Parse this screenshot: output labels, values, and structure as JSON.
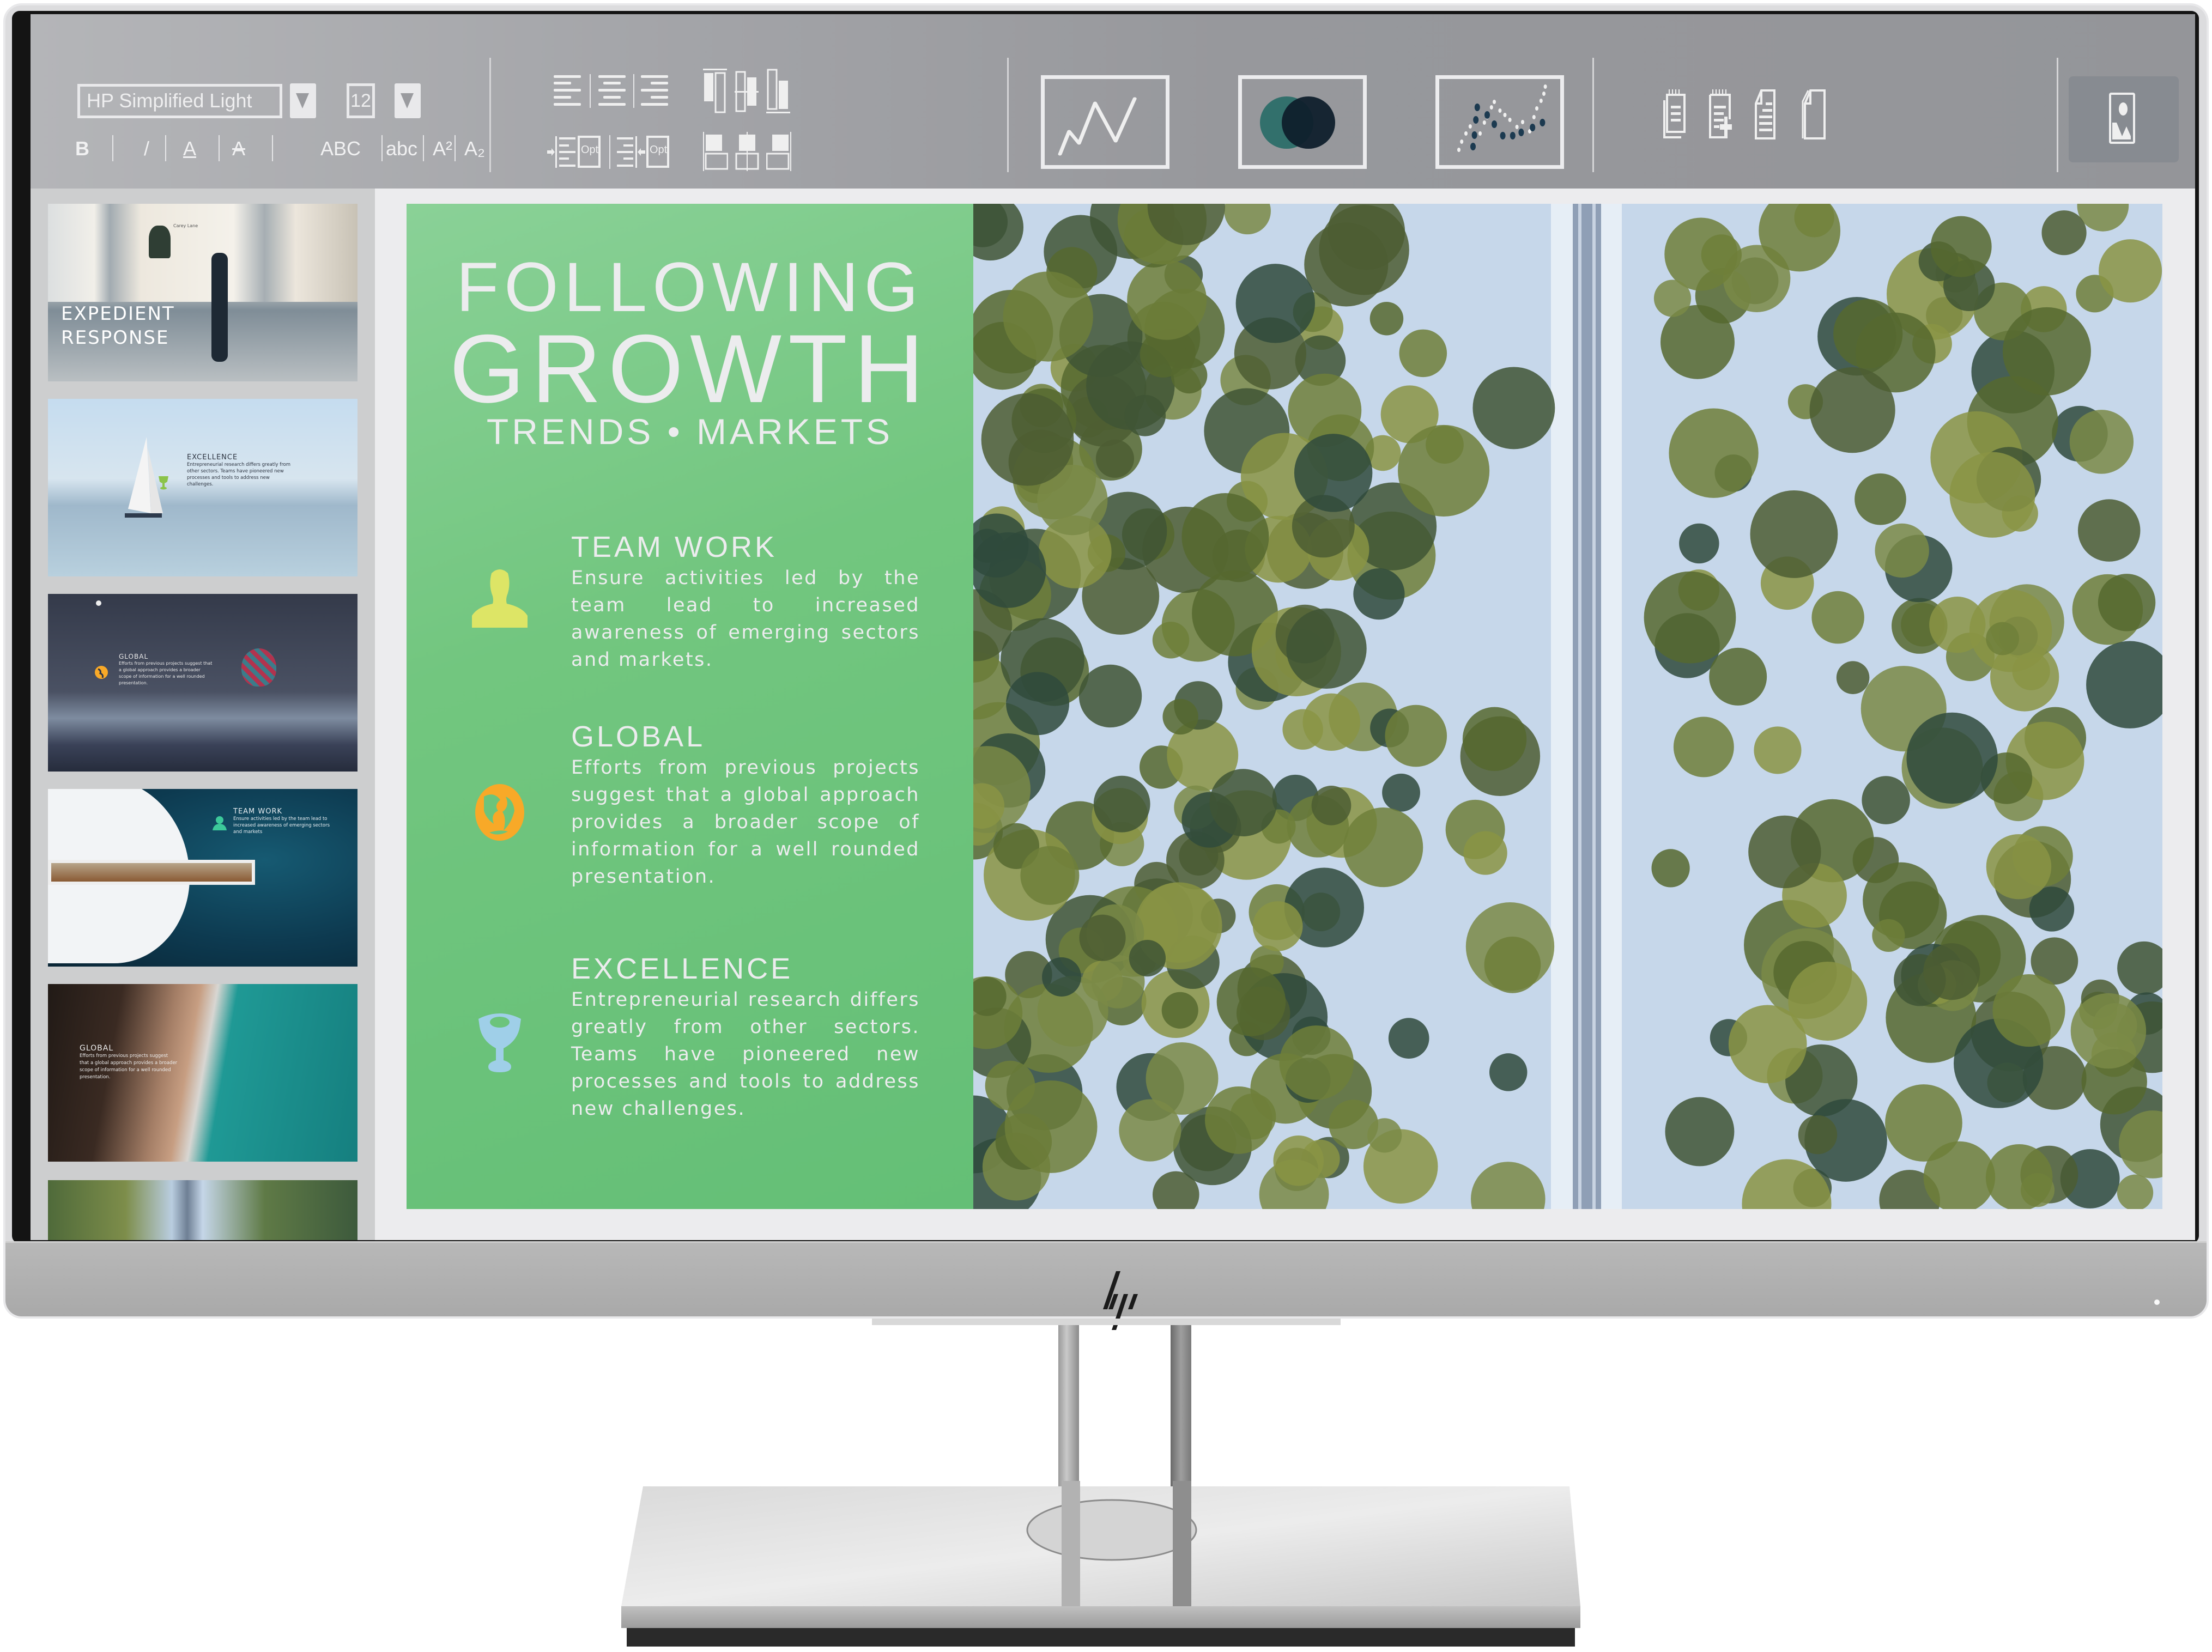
{
  "device": {
    "brand_logo": "hp-logo",
    "power_indicator": "power-led"
  },
  "toolbar": {
    "font_family": "HP Simplified Light",
    "font_size": "12",
    "format_buttons": [
      {
        "label": "B",
        "name": "bold"
      },
      {
        "label": "/",
        "name": "italic"
      },
      {
        "label": "A",
        "name": "underline"
      },
      {
        "label": "A",
        "name": "strikethrough"
      }
    ],
    "case_buttons": [
      {
        "label": "ABC",
        "name": "uppercase"
      },
      {
        "label": "abc",
        "name": "lowercase"
      },
      {
        "label": "A²",
        "name": "superscript"
      },
      {
        "label": "A₂",
        "name": "subscript"
      }
    ],
    "indent_opt_label": "Opt",
    "outdent_opt_label": "Opt",
    "chart_buttons": [
      "line-chart-icon",
      "venn-diagram-icon",
      "scatter-plot-icon"
    ],
    "page_buttons": [
      "notepad-stack-icon",
      "notepad-add-icon",
      "document-icon",
      "blank-pages-icon"
    ],
    "image_button": "image-icon",
    "venn_colors": [
      "#32706c",
      "#0f1f2c"
    ],
    "scatter_dot_color": "#1c3a50"
  },
  "thumbnails": [
    {
      "title_lines": [
        "EXPEDIENT",
        "RESPONSE"
      ],
      "sign": "Carey Lane",
      "scene": "storefront"
    },
    {
      "title": "EXCELLENCE",
      "body": "Entrepreneurial research differs greatly from other sectors. Teams have pioneered new processes and tools to address new challenges.",
      "scene": "sailboat"
    },
    {
      "title": "GLOBAL",
      "body": "Efforts from previous projects suggest that a global approach provides a broader scope of information for a well rounded presentation.",
      "scene": "balloon"
    },
    {
      "title": "TEAM WORK",
      "body": "Ensure activities led by the team lead to increased awareness of emerging sectors and markets",
      "scene": "anchor"
    },
    {
      "title": "GLOBAL",
      "body": "Efforts from previous projects suggest that a global approach provides a broader scope of information for a well rounded presentation.",
      "scene": "beach"
    },
    {
      "scene": "forest-road"
    }
  ],
  "slide": {
    "title_line1": "FOLLOWING",
    "title_line2": "GROWTH",
    "subtitle": "TRENDS • MARKETS",
    "panel_color": "#6cc47b",
    "features": [
      {
        "heading": "TEAM WORK",
        "body": "Ensure activities led by the team lead to increased awareness of emerging sectors and markets.",
        "icon": "person-icon",
        "icon_color": "#dde566"
      },
      {
        "heading": "GLOBAL",
        "body": "Efforts from previous projects suggest that a global approach provides a broader scope of information for a well rounded presentation.",
        "icon": "globe-icon",
        "icon_color": "#f8a928"
      },
      {
        "heading": "EXCELLENCE",
        "body": "Entrepreneurial research differs greatly from other sectors. Teams have pioneered new processes and tools to address new challenges.",
        "icon": "trophy-icon",
        "icon_color": "#9fcfe8"
      }
    ],
    "photo": "aerial-snowy-forest-road"
  }
}
